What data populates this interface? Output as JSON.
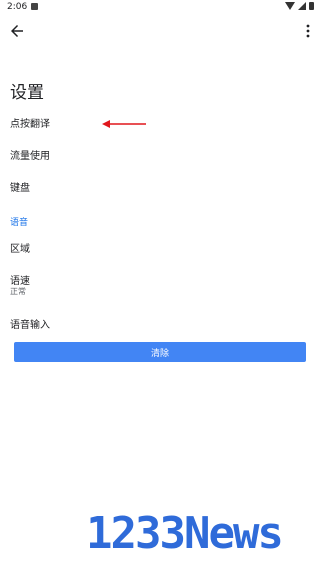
{
  "status_bar": {
    "time": "2:06"
  },
  "title": "设置",
  "items": [
    {
      "label": "点按翻译"
    },
    {
      "label": "流量使用"
    },
    {
      "label": "键盘"
    }
  ],
  "section": {
    "header": "语音"
  },
  "voice_items": [
    {
      "label": "区域"
    },
    {
      "label": "语速",
      "sub": "正常"
    },
    {
      "label": "语音输入"
    }
  ],
  "clear_button": {
    "label": "清除"
  },
  "watermark": {
    "text": "1233News"
  },
  "colors": {
    "accent": "#4285f4",
    "section": "#1a73e8",
    "arrow": "#e0161c",
    "watermark": "#2f6bd9"
  }
}
